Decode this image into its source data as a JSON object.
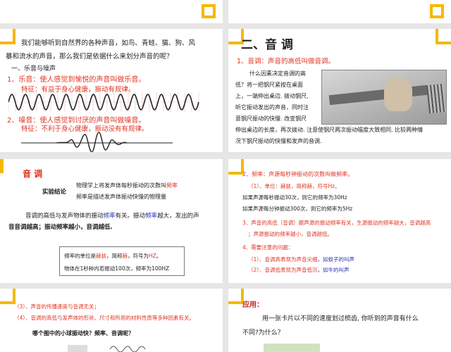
{
  "top_partial": {
    "left_bg": "#ffffff",
    "right_bg": "#ffffff"
  },
  "slide1": {
    "intro_line1": "我们能够听到自然界的各种声音，如鸟、青蛙、猫、狗、风",
    "intro_line2": "暴和流水的声音，那么我们是依据什么来划分声音的呢？",
    "section": "一、乐音与噪声",
    "item1": "1、乐音：使人感觉到愉悦的声音叫做乐音。",
    "item1_feature": "特征：有益于身心健康，振动有规律。",
    "item2": "2、噪音：使人感觉到讨厌的声音叫做噪音。",
    "item2_feature": "特征：不利于身心健康，振动没有有规律。"
  },
  "slide2": {
    "title": "二、音    调",
    "subtitle": "1、音调：声音的高低叫做音调。",
    "body_lines": [
      "什么因素决定音调的高",
      "低？将一把钢尺紧按在桌面",
      "上，一端伸出桌边. 拨动钢尺,",
      "听它振动发出的声音，同时注",
      "意钢尺振动的快慢. 改变钢尺",
      "伸出桌边的长度，再次拨动. 注意使钢尺两次振动幅度大致相同. 比较两种情",
      "况下钢尺振动的快慢和发声的音调."
    ]
  },
  "slide3": {
    "title": "音    调",
    "conclusion_label": "实验结论",
    "conclusion_line1_a": "物理学上将发声体每秒振动的次数叫",
    "conclusion_line1_b": "频率",
    "conclusion_line2": "频率是描述发声体振动快慢的物理量",
    "para_line1_a": "音调的高低与发声物体的振动",
    "para_line1_b": "频率",
    "para_line1_c": "有关。振动",
    "para_line1_d": "频率",
    "para_line1_e": "越大，发出的声",
    "para_line2": "音音调越高；振动频率越小，音调越低.",
    "box_line1_a": "频率的单位是",
    "box_line1_b": "赫兹",
    "box_line1_c": "，简称",
    "box_line1_d": "赫",
    "box_line1_e": "，符号为",
    "box_line1_f": "HZ",
    "box_line1_g": "。",
    "box_line2": "物体在1秒种内若振动100次，频率为100HZ"
  },
  "slide4": {
    "line1": "2、频率：声源每秒钟振动的次数叫做频率。",
    "line2": "（1）、单位：赫兹，简称赫，符号Hz。",
    "line3": "如果声源每秒振动30次，则它的频率为30Hz",
    "line4": "如果声源每分钟振动300次，则它的频率为5Hz",
    "line5": "3、声音的高低（音调）跟声源的振动频率有关，生源振动的频率越大，音调越高",
    "line6": "；声源振动的频率越小，音调越低。",
    "line7": "4、需要注意的问题：",
    "line8_a": "（1）、音调高表现为声音尖细",
    "line8_b": "，如蚊子的叫声",
    "line9_a": "（2）、音调低表现为声音低沉",
    "line9_b": "，如牛的叫声"
  },
  "slide5": {
    "line1": "（3）、声音的传播速度与音调无关；",
    "line2": "（4）、音调的高低与发声体的形状、尺寸和所用的材料性质等多种因素有关。",
    "question": "哪个图中的小球振动快？频率、音调呢？"
  },
  "slide6": {
    "title": "应用：",
    "line1": "用一张卡片以不同的速度划过梳齿, 你听到的声音有什么",
    "line2": "不同?为什么？"
  },
  "colors": {
    "accent": "#f5b800",
    "red": "#e03420",
    "blue": "#2a35b4"
  }
}
